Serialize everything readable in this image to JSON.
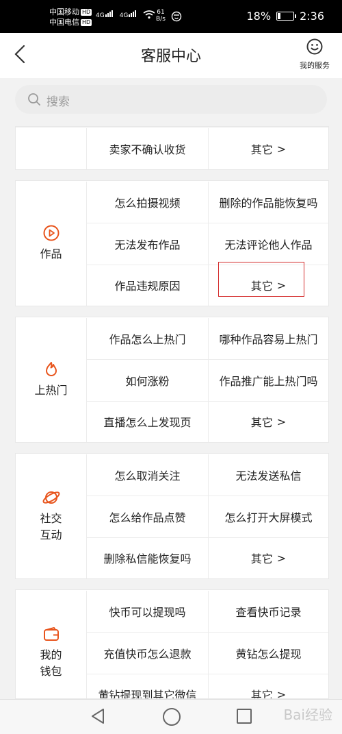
{
  "status_bar": {
    "carrier1": "中国移动",
    "carrier2": "中国电信",
    "hd": "HD",
    "net1": "4G",
    "net2": "4G",
    "speed_value": "61",
    "speed_unit": "B/s",
    "battery": "18%",
    "battery_level": 0.18,
    "time": "2:36"
  },
  "header": {
    "title": "客服中心",
    "my_service": "我的服务"
  },
  "search": {
    "placeholder": "搜索"
  },
  "accent": "#e8541c",
  "highlight_color": "#d42b2b",
  "sections": [
    {
      "category": "",
      "icon": "",
      "items": [
        "卖家不确认收货",
        "其它"
      ]
    },
    {
      "category": "作品",
      "icon": "play-circle-icon",
      "items": [
        "怎么拍摄视频",
        "删除的作品能恢复吗",
        "无法发布作品",
        "无法评论他人作品",
        "作品违规原因",
        "其它"
      ]
    },
    {
      "category": "上热门",
      "icon": "flame-icon",
      "items": [
        "作品怎么上热门",
        "哪种作品容易上热门",
        "如何涨粉",
        "作品推广能上热门吗",
        "直播怎么上发现页",
        "其它"
      ]
    },
    {
      "category": "社交\n互动",
      "icon": "planet-icon",
      "items": [
        "怎么取消关注",
        "无法发送私信",
        "怎么给作品点赞",
        "怎么打开大屏模式",
        "删除私信能恢复吗",
        "其它"
      ]
    },
    {
      "category": "我的\n钱包",
      "icon": "wallet-icon",
      "items": [
        "快币可以提现吗",
        "查看快币记录",
        "充值快币怎么退款",
        "黄钻怎么提现",
        "黄钻提现到其它微信",
        "其它"
      ]
    }
  ],
  "watermark": "Bai经验"
}
